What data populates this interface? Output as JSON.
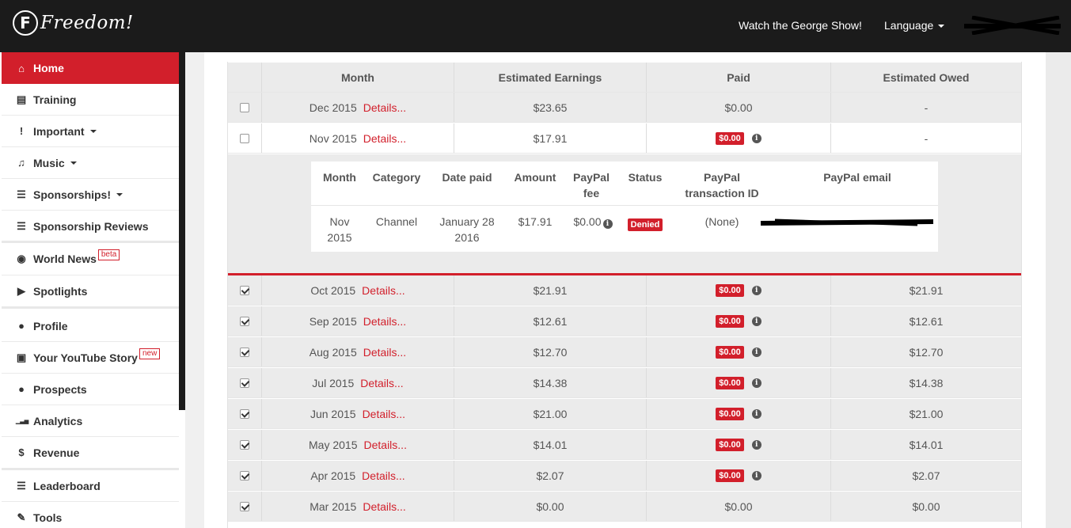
{
  "header": {
    "logo_letter": "F",
    "logo_text": "Freedom!",
    "nav": [
      {
        "label": "Watch the George Show!"
      },
      {
        "label": "Language"
      }
    ]
  },
  "sidebar": {
    "items": [
      {
        "label": "Home",
        "icon": "home-icon",
        "glyph": "⌂",
        "active": true
      },
      {
        "label": "Training",
        "icon": "book-icon",
        "glyph": "▤"
      },
      {
        "label": "Important",
        "icon": "exclamation-icon",
        "glyph": "!",
        "caret": true
      },
      {
        "label": "Music",
        "icon": "music-icon",
        "glyph": "♫",
        "caret": true
      },
      {
        "label": "Sponsorships!",
        "icon": "list-icon",
        "glyph": "☰",
        "caret": true
      },
      {
        "label": "Sponsorship Reviews",
        "icon": "list-icon",
        "glyph": "☰"
      },
      {
        "label": "World News",
        "icon": "globe-icon",
        "glyph": "◉",
        "badge": "beta"
      },
      {
        "label": "Spotlights",
        "icon": "youtube-play-icon",
        "glyph": "▶"
      },
      {
        "label": "Profile",
        "icon": "user-icon",
        "glyph": "●"
      },
      {
        "label": "Your YouTube Story",
        "icon": "youtube-icon",
        "glyph": "▣",
        "badge": "new"
      },
      {
        "label": "Prospects",
        "icon": "users-icon",
        "glyph": "●"
      },
      {
        "label": "Analytics",
        "icon": "signal-icon",
        "glyph": "▁▃▅"
      },
      {
        "label": "Revenue",
        "icon": "dollar-icon",
        "glyph": "$"
      },
      {
        "label": "Leaderboard",
        "icon": "list-icon",
        "glyph": "☰"
      },
      {
        "label": "Tools",
        "icon": "wrench-icon",
        "glyph": "✎"
      }
    ]
  },
  "table": {
    "columns": [
      "Month",
      "Estimated Earnings",
      "Paid",
      "Estimated Owed"
    ],
    "details_label": "Details...",
    "rows": [
      {
        "month": "Dec 2015",
        "earnings": "$23.65",
        "paid": "$0.00",
        "paid_badge": false,
        "owed": "-",
        "checked": false
      },
      {
        "month": "Nov 2015",
        "earnings": "$17.91",
        "paid": "$0.00",
        "paid_badge": true,
        "owed": "-",
        "checked": false
      },
      {
        "month": "Oct 2015",
        "earnings": "$21.91",
        "paid": "$0.00",
        "paid_badge": true,
        "owed": "$21.91",
        "checked": true
      },
      {
        "month": "Sep 2015",
        "earnings": "$12.61",
        "paid": "$0.00",
        "paid_badge": true,
        "owed": "$12.61",
        "checked": true
      },
      {
        "month": "Aug 2015",
        "earnings": "$12.70",
        "paid": "$0.00",
        "paid_badge": true,
        "owed": "$12.70",
        "checked": true
      },
      {
        "month": "Jul 2015",
        "earnings": "$14.38",
        "paid": "$0.00",
        "paid_badge": true,
        "owed": "$14.38",
        "checked": true
      },
      {
        "month": "Jun 2015",
        "earnings": "$21.00",
        "paid": "$0.00",
        "paid_badge": true,
        "owed": "$21.00",
        "checked": true
      },
      {
        "month": "May 2015",
        "earnings": "$14.01",
        "paid": "$0.00",
        "paid_badge": true,
        "owed": "$14.01",
        "checked": true
      },
      {
        "month": "Apr 2015",
        "earnings": "$2.07",
        "paid": "$0.00",
        "paid_badge": true,
        "owed": "$2.07",
        "checked": true
      },
      {
        "month": "Mar 2015",
        "earnings": "$0.00",
        "paid": "$0.00",
        "paid_badge": false,
        "owed": "$0.00",
        "checked": true
      }
    ]
  },
  "payment_detail": {
    "headers": {
      "month": "Month",
      "category": "Category",
      "date_paid": "Date paid",
      "amount": "Amount",
      "fee_1": "PayPal",
      "fee_2": "fee",
      "status": "Status",
      "txn_1": "PayPal",
      "txn_2": "transaction ID",
      "email": "PayPal email"
    },
    "values": {
      "month_1": "Nov",
      "month_2": "2015",
      "category": "Channel",
      "date_1": "January 28",
      "date_2": "2016",
      "amount": "$17.91",
      "fee": "$0.00",
      "status": "Denied",
      "txn": "(None)"
    }
  },
  "colors": {
    "accent": "#d21f2b",
    "topbar": "#1b1b1b"
  }
}
